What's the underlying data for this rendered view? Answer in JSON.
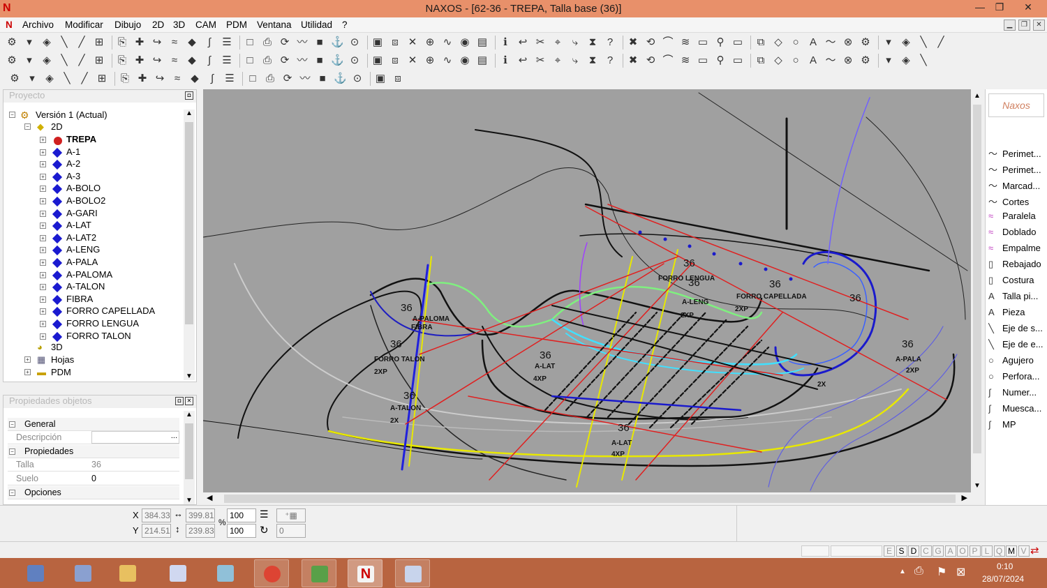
{
  "window": {
    "title": "NAXOS - [62-36 - TREPA, Talla base (36)]",
    "min": "—",
    "max": "❐",
    "close": "✕"
  },
  "menu": [
    "Archivo",
    "Modificar",
    "Dibujo",
    "2D",
    "3D",
    "CAM",
    "PDM",
    "Ventana",
    "Utilidad",
    "?"
  ],
  "project": {
    "header": "Proyecto",
    "root": "Versión 1 (Actual)",
    "node2d": "2D",
    "items": [
      "TREPA",
      "A-1",
      "A-2",
      "A-3",
      "A-BOLO",
      "A-BOLO2",
      "A-GARI",
      "A-LAT",
      "A-LAT2",
      "A-LENG",
      "A-PALA",
      "A-PALOMA",
      "A-TALON",
      "FIBRA",
      "FORRO CAPELLADA",
      "FORRO LENGUA",
      "FORRO TALON"
    ],
    "node3d": "3D",
    "hojas": "Hojas",
    "pdm": "PDM"
  },
  "props": {
    "header": "Propiedades objetos",
    "general": "General",
    "descripcion": "Descripción",
    "propiedades": "Propiedades",
    "talla_label": "Talla",
    "talla": "36",
    "suelo_label": "Suelo",
    "suelo": "0",
    "opciones": "Opciones",
    "ellipsis": "..."
  },
  "canvas_labels": {
    "s1": "36",
    "s2": "36",
    "s3": "36",
    "s4": "36",
    "s5": "36",
    "s6": "36",
    "s7": "36",
    "s8": "36",
    "s9": "36",
    "s10": "36",
    "forro_lengua": "FORRO LENGUA",
    "forro_capellada": "FORRO CAPELLADA",
    "forro_talon": "FORRO TALON",
    "a_leng": "A-LENG",
    "a_paloma": "A-PALOMA",
    "fibra": "FIBRA",
    "a_lat": "A-LAT",
    "a_talon": "A-TALON",
    "a_lat2": "A-LAT",
    "a_pala": "A-PALA",
    "x2p_1": "2XP",
    "x2p_2": "2XP",
    "x2p_3": "2XP",
    "x2p_4": "2XP",
    "x2_1": "2X",
    "x2_2": "2X",
    "x4p_1": "4XP",
    "x4p_2": "4XP"
  },
  "right_panel": {
    "logo": "Naxos",
    "items": [
      {
        "g": "〜",
        "label": "Perimet..."
      },
      {
        "g": "〜",
        "label": "Perimet..."
      },
      {
        "g": "〜",
        "label": "Marcad..."
      },
      {
        "g": "〜",
        "label": "Cortes"
      },
      {
        "g": "≈",
        "label": "Paralela"
      },
      {
        "g": "≈",
        "label": "Doblado"
      },
      {
        "g": "≈",
        "label": "Empalme"
      },
      {
        "g": "▯",
        "label": "Rebajado"
      },
      {
        "g": "▯",
        "label": "Costura"
      },
      {
        "g": "A",
        "label": "Talla pi..."
      },
      {
        "g": "A",
        "label": "Pieza"
      },
      {
        "g": "╲",
        "label": "Eje de s..."
      },
      {
        "g": "╲",
        "label": "Eje de e..."
      },
      {
        "g": "○",
        "label": "Agujero"
      },
      {
        "g": "○",
        "label": "Perfora..."
      },
      {
        "g": "∫",
        "label": "Numer..."
      },
      {
        "g": "∫",
        "label": "Muesca..."
      },
      {
        "g": "∫",
        "label": "MP"
      }
    ]
  },
  "coords": {
    "x_label": "X",
    "y_label": "Y",
    "x": "384.33",
    "y": "214.51",
    "w": "399.81",
    "h": "239.83",
    "pct_label": "%",
    "sx": "100",
    "sy": "100",
    "rot": "0"
  },
  "status": {
    "letters": [
      "E",
      "S",
      "D",
      "C",
      "G",
      "A",
      "O",
      "P",
      "L",
      "Q",
      "M",
      "V"
    ]
  },
  "tray": {
    "time": "0:10",
    "date": "28/07/2024"
  },
  "colors": {
    "titlebar": "#e8906a",
    "taskbar": "#b86440",
    "canvas": "#a0a0a0"
  }
}
